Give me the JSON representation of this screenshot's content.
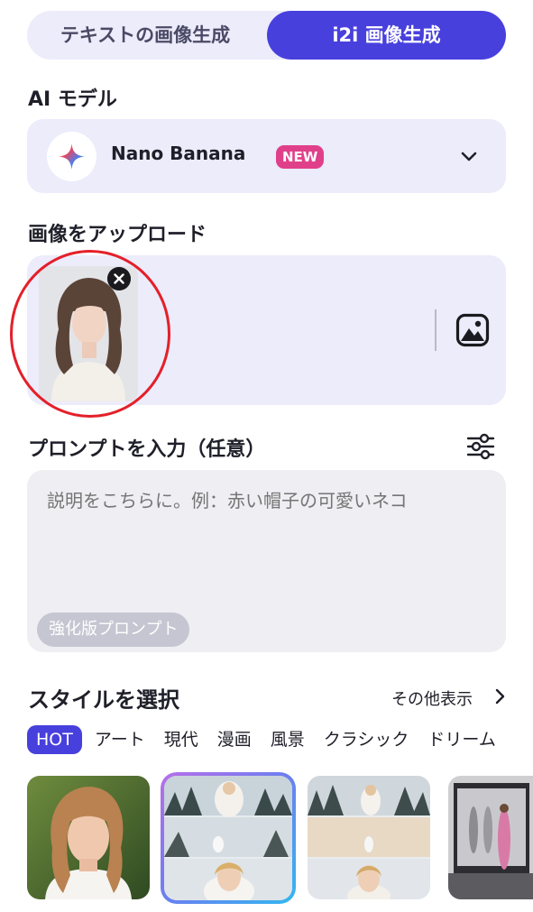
{
  "tabs": [
    {
      "label": "テキストの画像生成",
      "active": false
    },
    {
      "label": "i2i 画像生成",
      "active": true
    }
  ],
  "model": {
    "section_title": "AI モデル",
    "name": "Nano Banana",
    "badge": "NEW",
    "icon": "sparkle-icon"
  },
  "upload": {
    "section_title": "画像をアップロード",
    "has_image": true,
    "remove_icon": "close-icon",
    "gallery_icon": "image-icon"
  },
  "prompt": {
    "section_title": "プロンプトを入力（任意）",
    "placeholder": "説明をこちらに。例：赤い帽子の可愛いネコ",
    "enhance_label": "強化版プロンプト",
    "settings_icon": "sliders-icon"
  },
  "styles": {
    "section_title": "スタイルを選択",
    "more_label": "その他表示",
    "categories": [
      "HOT",
      "アート",
      "現代",
      "漫画",
      "風景",
      "クラシック",
      "ドリーム"
    ],
    "active_category": "HOT",
    "selected_index": 1
  },
  "colors": {
    "accent": "#4840dd",
    "panel": "#ececfb",
    "badge": "#e0408a",
    "annotation": "#e4202a"
  }
}
